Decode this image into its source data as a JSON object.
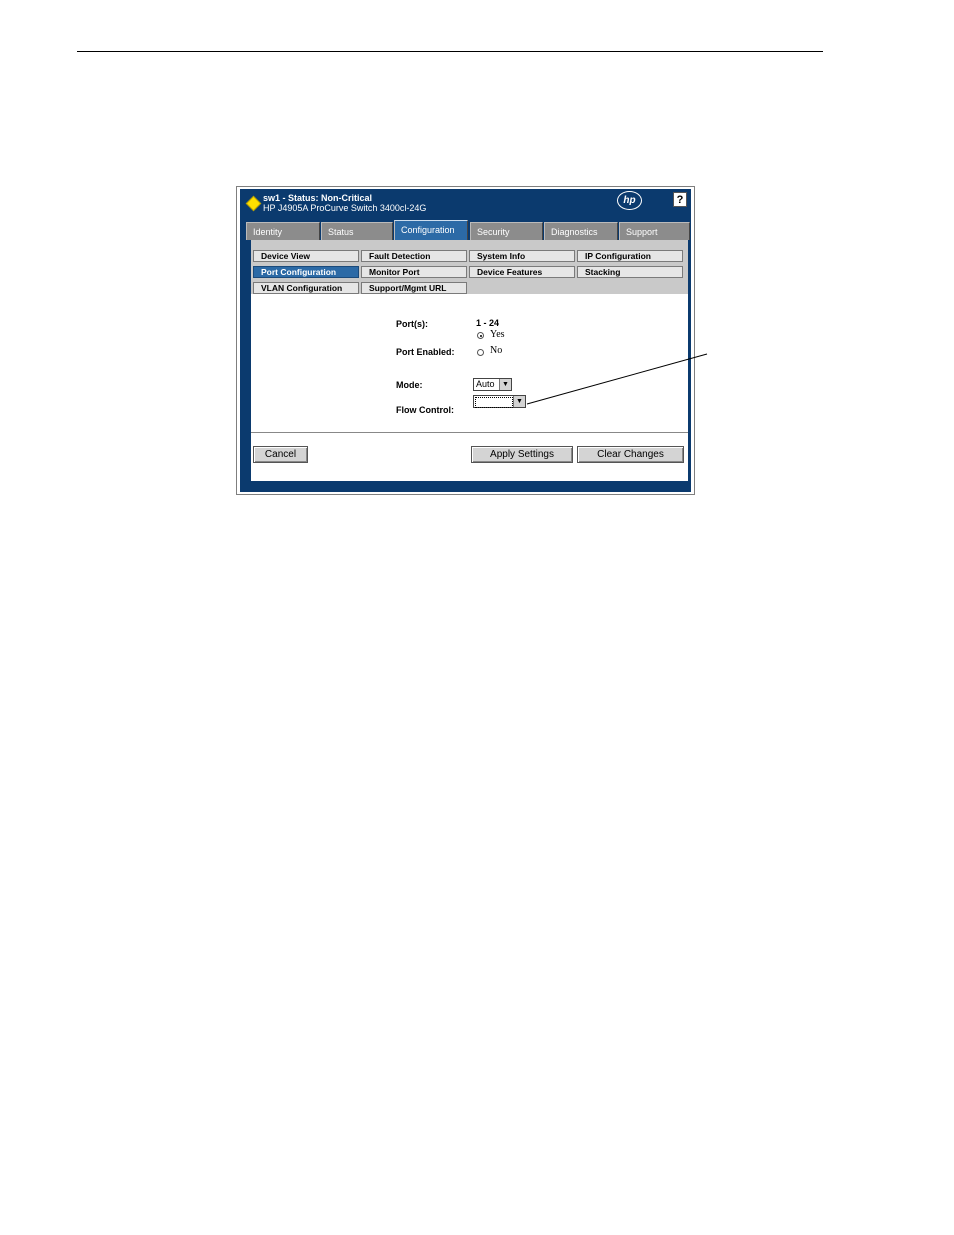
{
  "header": {
    "title_line1": "sw1 - Status: Non-Critical",
    "title_line2": "HP J4905A ProCurve Switch 3400cl-24G",
    "logo_text": "hp",
    "help_label": "?",
    "status_color": "#ffe000"
  },
  "tabs": [
    {
      "label": "Identity",
      "active": false
    },
    {
      "label": "Status",
      "active": false
    },
    {
      "label": "Configuration",
      "active": true
    },
    {
      "label": "Security",
      "active": false
    },
    {
      "label": "Diagnostics",
      "active": false
    },
    {
      "label": "Support",
      "active": false
    }
  ],
  "nav": [
    {
      "label": "Device View",
      "active": false
    },
    {
      "label": "Fault Detection",
      "active": false
    },
    {
      "label": "System Info",
      "active": false
    },
    {
      "label": "IP Configuration",
      "active": false
    },
    {
      "label": "Port Configuration",
      "active": true
    },
    {
      "label": "Monitor Port",
      "active": false
    },
    {
      "label": "Device Features",
      "active": false
    },
    {
      "label": "Stacking",
      "active": false
    },
    {
      "label": "VLAN Configuration",
      "active": false
    },
    {
      "label": "Support/Mgmt URL",
      "active": false
    }
  ],
  "form": {
    "ports_label": "Port(s):",
    "ports_value": "1 - 24",
    "port_enabled_label": "Port Enabled:",
    "yes_label": "Yes",
    "no_label": "No",
    "port_enabled_value": "Yes",
    "mode_label": "Mode:",
    "mode_value": "Auto",
    "flow_control_label": "Flow Control:",
    "flow_control_value": ""
  },
  "buttons": {
    "cancel": "Cancel",
    "apply": "Apply Settings",
    "clear": "Clear Changes"
  },
  "colors": {
    "frame": "#0b3a6e",
    "active_tab": "#2c6aa6",
    "nav_panel": "#c9c9c9"
  }
}
